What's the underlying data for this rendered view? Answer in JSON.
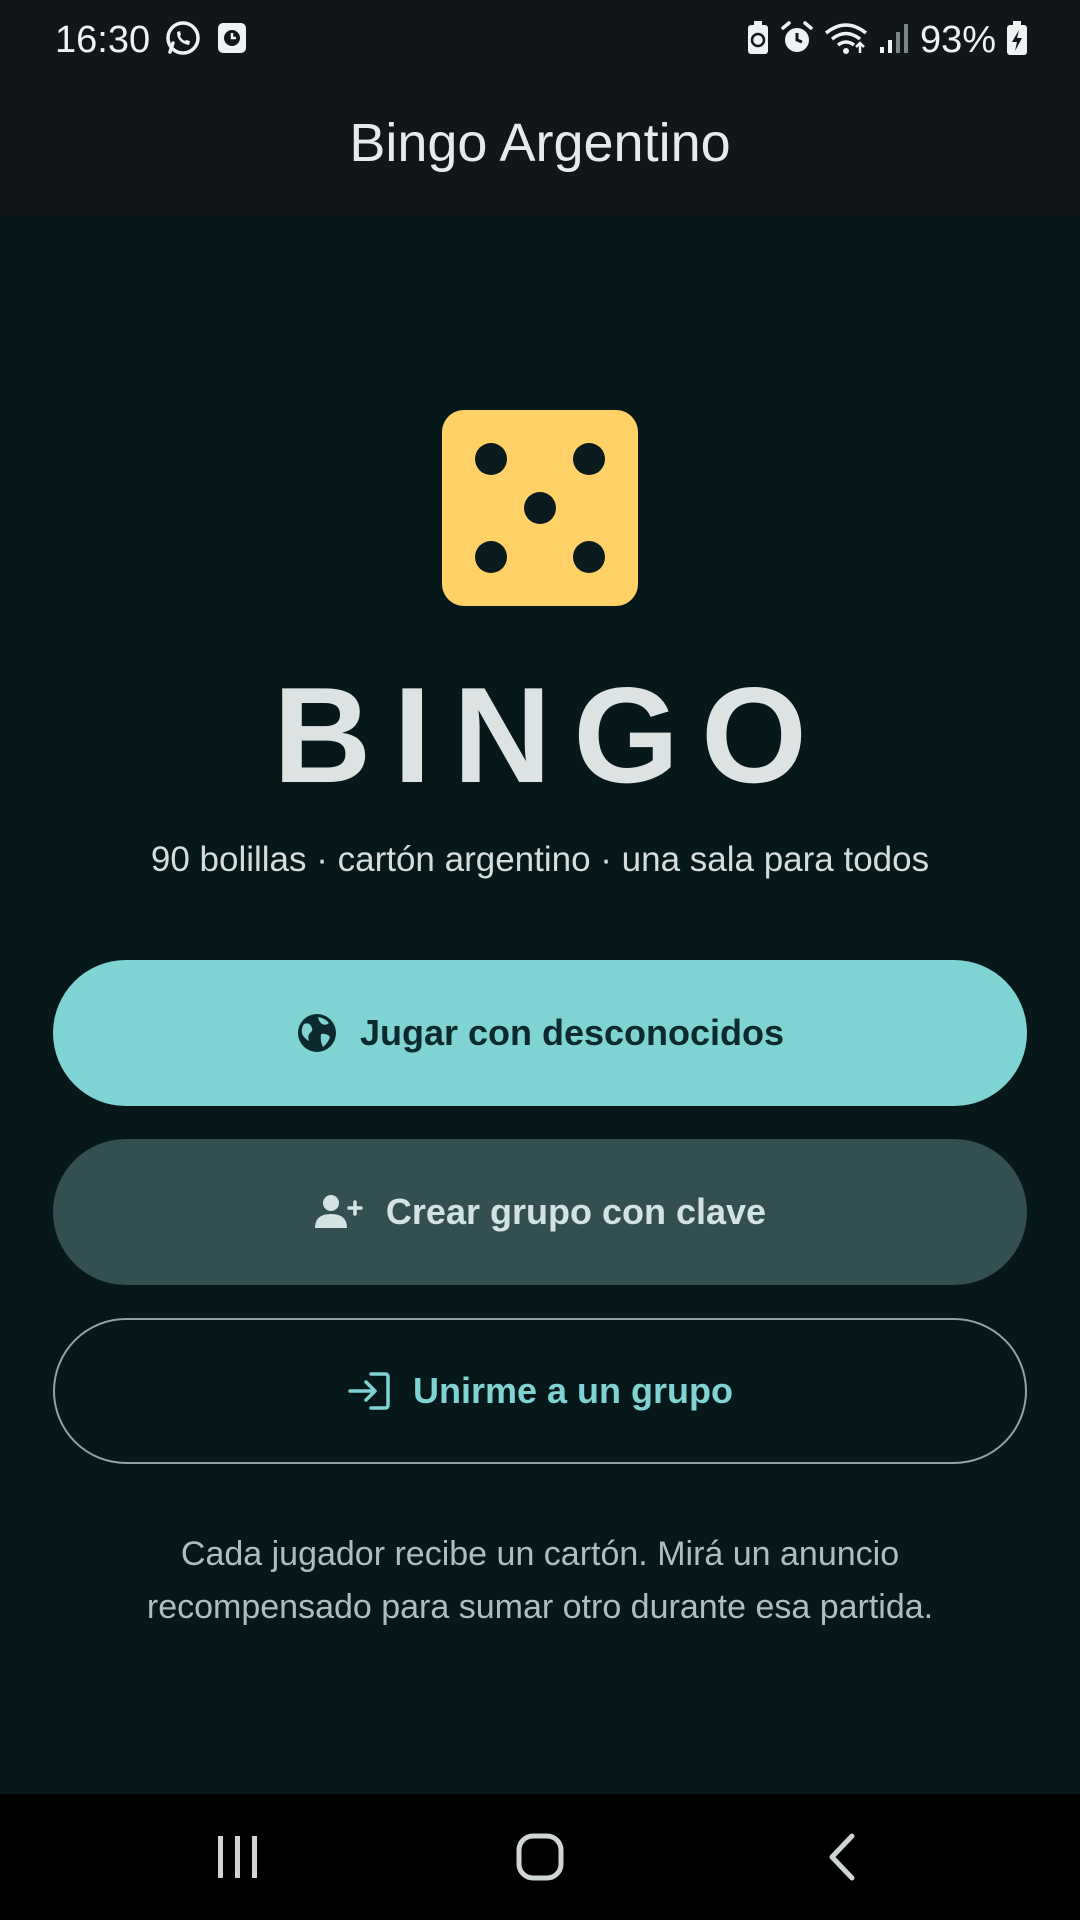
{
  "status_bar": {
    "time": "16:30",
    "battery": "93%",
    "left_icons": [
      "whatsapp-icon",
      "clock-notification-icon"
    ],
    "right_icons": [
      "battery-saver-icon",
      "alarm-icon",
      "wifi-icon",
      "signal-icon",
      "battery-charging-icon"
    ]
  },
  "app_bar": {
    "title": "Bingo Argentino"
  },
  "hero": {
    "icon": "dice-five-icon",
    "title": "BINGO",
    "subtitle": "90 bolillas · cartón argentino · una sala para todos"
  },
  "buttons": {
    "play_strangers": {
      "label": "Jugar con desconocidos",
      "icon": "globe-icon"
    },
    "create_group": {
      "label": "Crear grupo con clave",
      "icon": "add-person-icon"
    },
    "join_group": {
      "label": "Unirme a un grupo",
      "icon": "login-icon"
    }
  },
  "footer": {
    "line1": "Cada jugador recibe un cartón. Mirá un anuncio",
    "line2": "recompensado para sumar otro durante esa partida."
  },
  "colors": {
    "background": "#07181b",
    "primary": "#7fd3d3",
    "secondary": "#344f52",
    "dice": "#ffd166"
  },
  "nav_bar": {
    "items": [
      "recent-apps-icon",
      "home-icon",
      "back-icon"
    ]
  }
}
